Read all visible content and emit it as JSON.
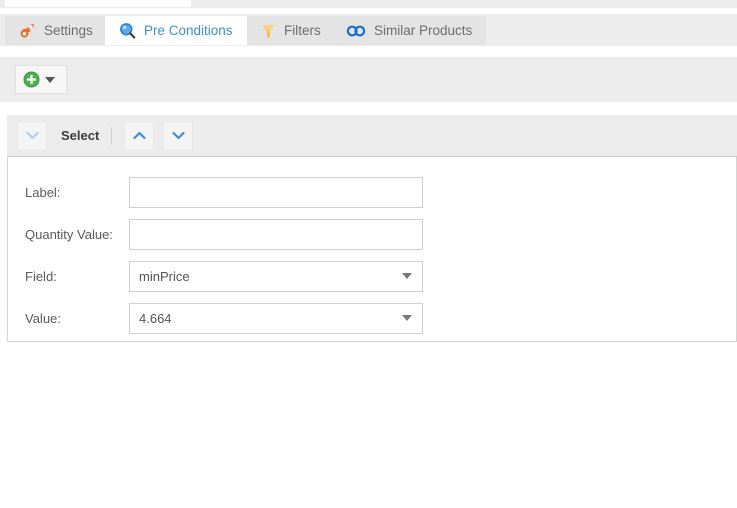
{
  "window": {
    "background_color": "#ffffff",
    "panel_gray": "#ececec"
  },
  "tabs": [
    {
      "id": "settings",
      "label": "Settings",
      "icon": "gears-icon",
      "icon_color": "#e8732a",
      "active": false
    },
    {
      "id": "pre-conditions",
      "label": "Pre Conditions",
      "icon": "magnifier-icon",
      "icon_color": "#3d8fd6",
      "active": true
    },
    {
      "id": "filters",
      "label": "Filters",
      "icon": "funnel-icon",
      "icon_color": "#f5b942",
      "active": false
    },
    {
      "id": "similar-products",
      "label": "Similar Products",
      "icon": "linked-circles-icon",
      "icon_color": "#2b7fd4",
      "active": false
    }
  ],
  "toolbar": {
    "add_button": {
      "icon": "plus-circle-icon",
      "icon_color": "#4caf50",
      "dropdown_icon": "caret-down-icon"
    }
  },
  "section": {
    "title": "Select",
    "collapse_icon": "chevron-down-icon",
    "collapse_icon_color": "#a8d3f0",
    "move_up_icon": "chevron-up-icon",
    "move_down_icon": "chevron-down-icon",
    "move_icon_color": "#3d8fd6"
  },
  "form": {
    "rows": [
      {
        "id": "label",
        "label": "Label:",
        "type": "text",
        "value": "",
        "placeholder": ""
      },
      {
        "id": "quantity-value",
        "label": "Quantity Value:",
        "type": "text",
        "value": "",
        "placeholder": ""
      },
      {
        "id": "field",
        "label": "Field:",
        "type": "select",
        "value": "minPrice"
      },
      {
        "id": "value",
        "label": "Value:",
        "type": "select",
        "value": "4.664"
      }
    ]
  }
}
